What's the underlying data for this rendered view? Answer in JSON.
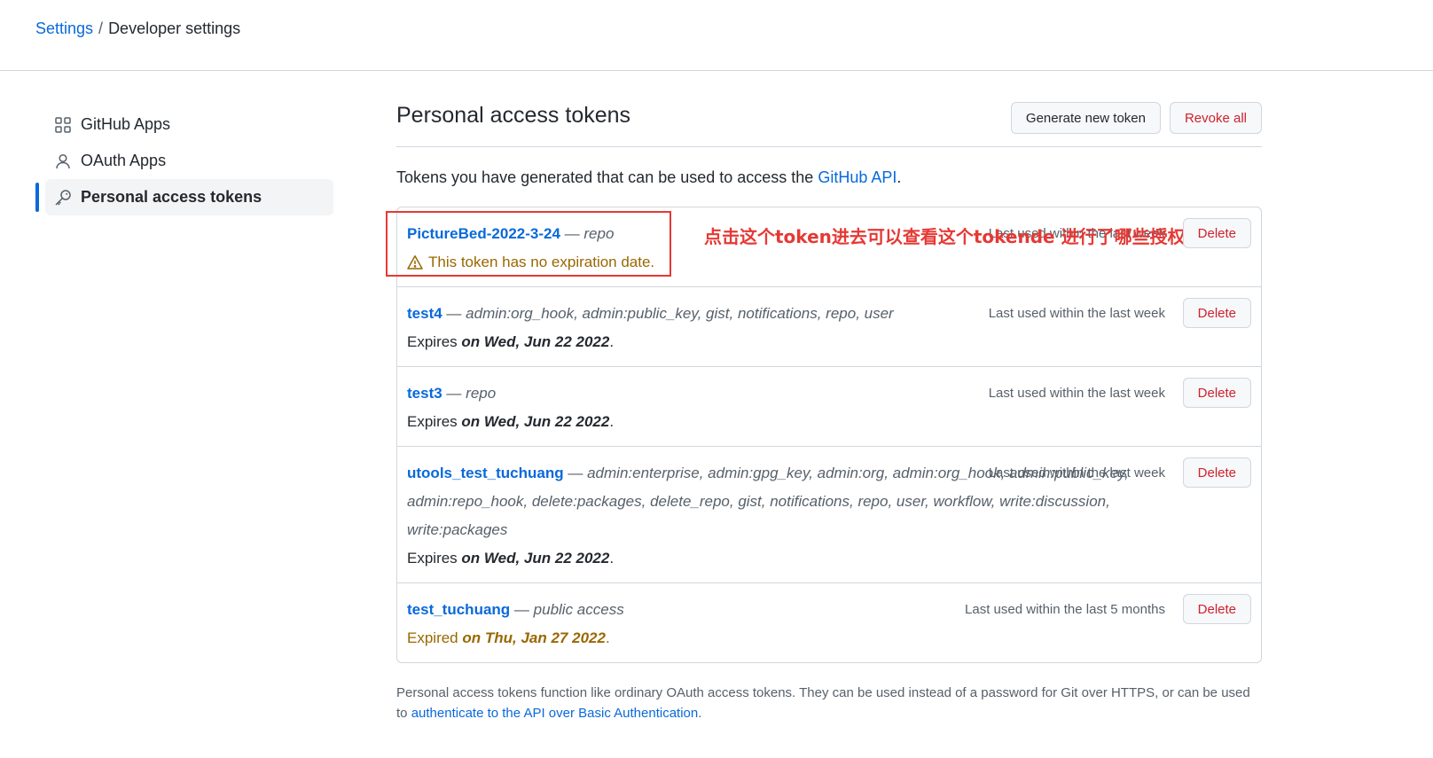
{
  "breadcrumb": {
    "settings": "Settings",
    "separator": "/",
    "current": "Developer settings"
  },
  "sidebar": {
    "items": [
      {
        "label": "GitHub Apps",
        "icon": "apps-grid-icon"
      },
      {
        "label": "OAuth Apps",
        "icon": "person-icon"
      },
      {
        "label": "Personal access tokens",
        "icon": "key-icon",
        "active": true
      }
    ]
  },
  "main": {
    "title": "Personal access tokens",
    "generate_label": "Generate new token",
    "revoke_label": "Revoke all",
    "intro_text": "Tokens you have generated that can be used to access the ",
    "intro_link": "GitHub API",
    "intro_end": ".",
    "dash": "—",
    "delete_label": "Delete",
    "expires_prefix": "Expires ",
    "expired_prefix": "Expired ",
    "tokens": [
      {
        "name": "PictureBed-2022-3-24",
        "scopes": "repo",
        "last_used": "Last used within the last week",
        "warning": "This token has no expiration date."
      },
      {
        "name": "test4",
        "scopes": "admin:org_hook, admin:public_key, gist, notifications, repo, user",
        "last_used": "Last used within the last week",
        "expires": "on Wed, Jun 22 2022"
      },
      {
        "name": "test3",
        "scopes": "repo",
        "last_used": "Last used within the last week",
        "expires": "on Wed, Jun 22 2022"
      },
      {
        "name": "utools_test_tuchuang",
        "scopes": "admin:enterprise, admin:gpg_key, admin:org, admin:org_hook, admin:public_key, admin:repo_hook, delete:packages, delete_repo, gist, notifications, repo, user, workflow, write:discussion, write:packages",
        "last_used": "Last used within the last week",
        "expires": "on Wed, Jun 22 2022"
      },
      {
        "name": "test_tuchuang",
        "scopes": "public access",
        "last_used": "Last used within the last 5 months",
        "expired": "on Thu, Jan 27 2022"
      }
    ],
    "annotation": "点击这个token进去可以查看这个tokende 进行了哪些授权",
    "footnote_text": "Personal access tokens function like ordinary OAuth access tokens. They can be used instead of a password for Git over HTTPS, or can be used to ",
    "footnote_link": "authenticate to the API over Basic Authentication",
    "footnote_end": "."
  },
  "colors": {
    "link": "#0969da",
    "danger": "#cf222e",
    "warning": "#9a6700",
    "annotation": "#e53935",
    "active_bar": "#0969da"
  }
}
